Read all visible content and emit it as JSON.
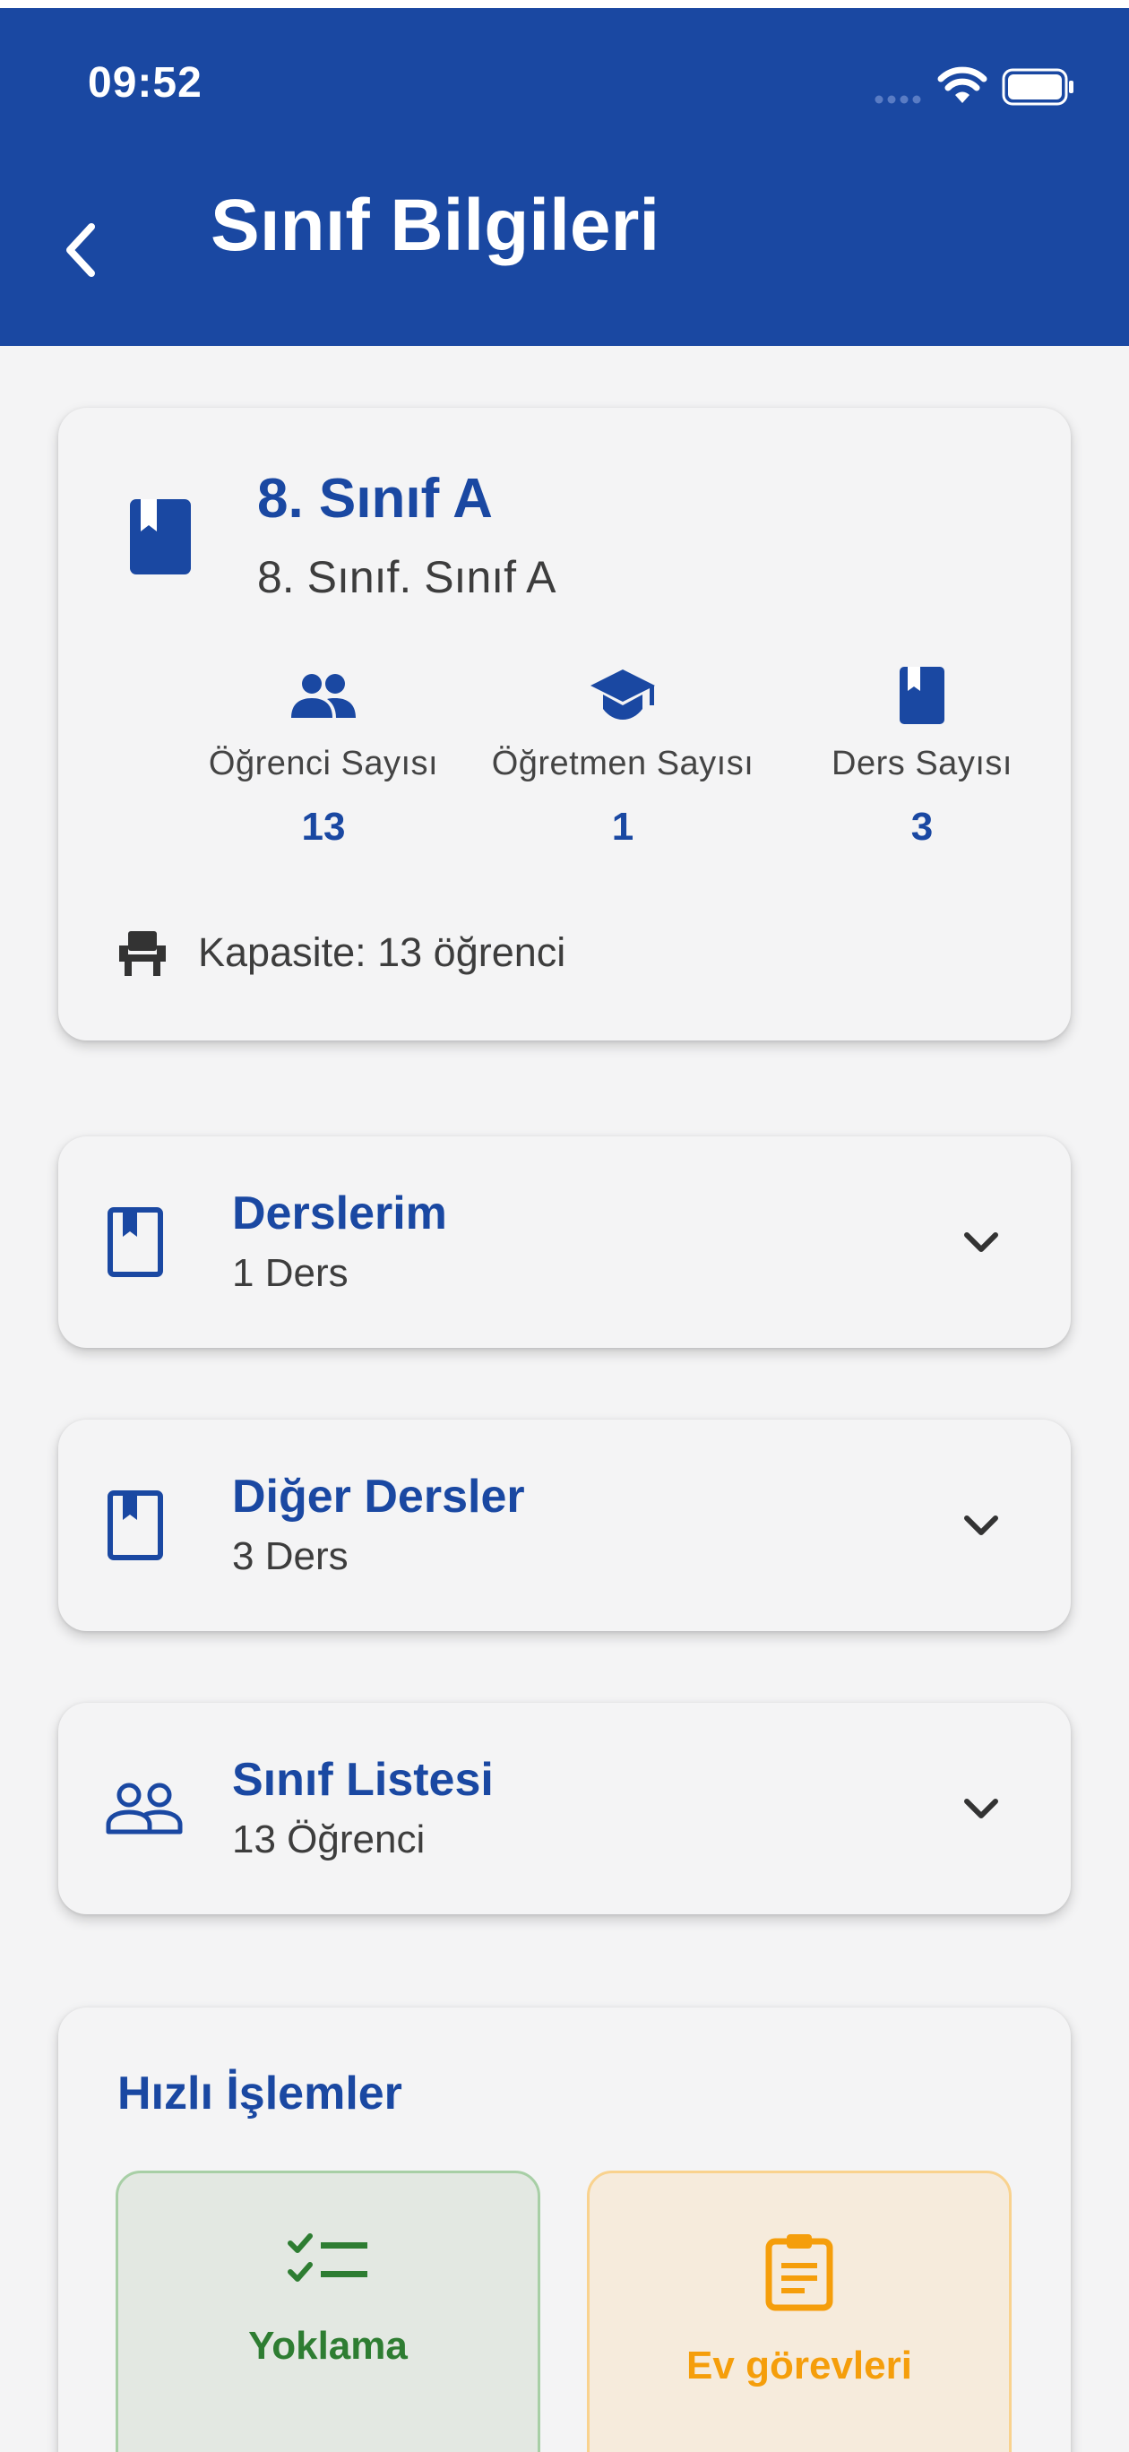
{
  "status_bar": {
    "time": "09:52"
  },
  "header": {
    "title": "Sınıf Bilgileri"
  },
  "class_card": {
    "name": "8. Sınıf A",
    "subtitle": "8. Sınıf. Sınıf A",
    "stats": [
      {
        "icon": "people-icon",
        "label": "Öğrenci Sayısı",
        "value": "13"
      },
      {
        "icon": "graduation-cap-icon",
        "label": "Öğretmen Sayısı",
        "value": "1"
      },
      {
        "icon": "book-icon",
        "label": "Ders Sayısı",
        "value": "3"
      }
    ],
    "capacity": "Kapasite: 13 öğrenci"
  },
  "sections": [
    {
      "icon": "book-outline-icon",
      "title": "Derslerim",
      "subtitle": "1 Ders"
    },
    {
      "icon": "book-outline-icon",
      "title": "Diğer Dersler",
      "subtitle": "3 Ders"
    },
    {
      "icon": "people-outline-icon",
      "title": "Sınıf Listesi",
      "subtitle": "13 Öğrenci"
    }
  ],
  "quick_actions": {
    "title": "Hızlı İşlemler",
    "items": [
      {
        "icon": "checklist-icon",
        "label": "Yoklama",
        "color": "#2e7d32"
      },
      {
        "icon": "clipboard-icon",
        "label": "Ev görevleri",
        "color": "#f59e0b"
      }
    ]
  },
  "colors": {
    "primary": "#1a48a2",
    "background": "#f4f4f5",
    "attendance_bg": "#e3e8e2",
    "homework_bg": "#f6ebdc"
  }
}
